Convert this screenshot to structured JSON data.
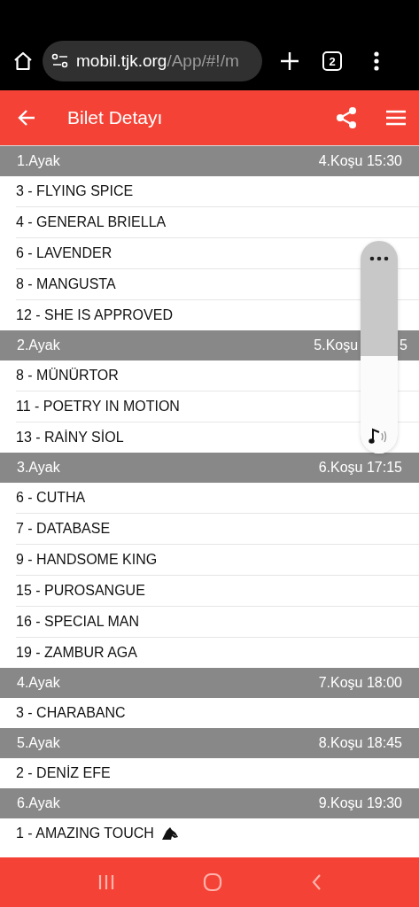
{
  "browser": {
    "url_host": "mobil.tjk.org",
    "url_path": "/App/#!/m",
    "tab_count": "2"
  },
  "app_bar": {
    "title": "Bilet Detayı"
  },
  "legs": [
    {
      "leg": "1.Ayak",
      "race": [
        "4.Koşu 15:30"
      ],
      "horses": [
        {
          "name": "3 - FLYING SPICE",
          "icon": false
        },
        {
          "name": "4 - GENERAL BRIELLA",
          "icon": false
        },
        {
          "name": "6 - LAVENDER",
          "icon": false
        },
        {
          "name": "8 - MANGUSTA",
          "icon": false
        },
        {
          "name": "12 - SHE IS APPROVED",
          "icon": false
        }
      ]
    },
    {
      "leg": "2.Ayak",
      "race": [
        "5.Koşu",
        "5"
      ],
      "horses": [
        {
          "name": "8 - MÜNÜRTOR",
          "icon": false
        },
        {
          "name": "11 - POETRY IN MOTION",
          "icon": false
        },
        {
          "name": "13 - RAİNY SİOL",
          "icon": false
        }
      ]
    },
    {
      "leg": "3.Ayak",
      "race": [
        "6.Koşu 17:15"
      ],
      "horses": [
        {
          "name": "6 - CUTHA",
          "icon": false
        },
        {
          "name": "7 - DATABASE",
          "icon": false
        },
        {
          "name": "9 - HANDSOME KING",
          "icon": false
        },
        {
          "name": "15 - PUROSANGUE",
          "icon": false
        },
        {
          "name": "16 - SPECIAL MAN",
          "icon": false
        },
        {
          "name": "19 - ZAMBUR AGA",
          "icon": false
        }
      ]
    },
    {
      "leg": "4.Ayak",
      "race": [
        "7.Koşu 18:00"
      ],
      "horses": [
        {
          "name": "3 - CHARABANC",
          "icon": false
        }
      ]
    },
    {
      "leg": "5.Ayak",
      "race": [
        "8.Koşu 18:45"
      ],
      "horses": [
        {
          "name": "2 - DENİZ EFE",
          "icon": false
        }
      ]
    },
    {
      "leg": "6.Ayak",
      "race": [
        "9.Koşu 19:30"
      ],
      "horses": [
        {
          "name": "1 - AMAZING TOUCH",
          "icon": true
        }
      ]
    }
  ],
  "volume_panel": {
    "level": 0.46
  }
}
